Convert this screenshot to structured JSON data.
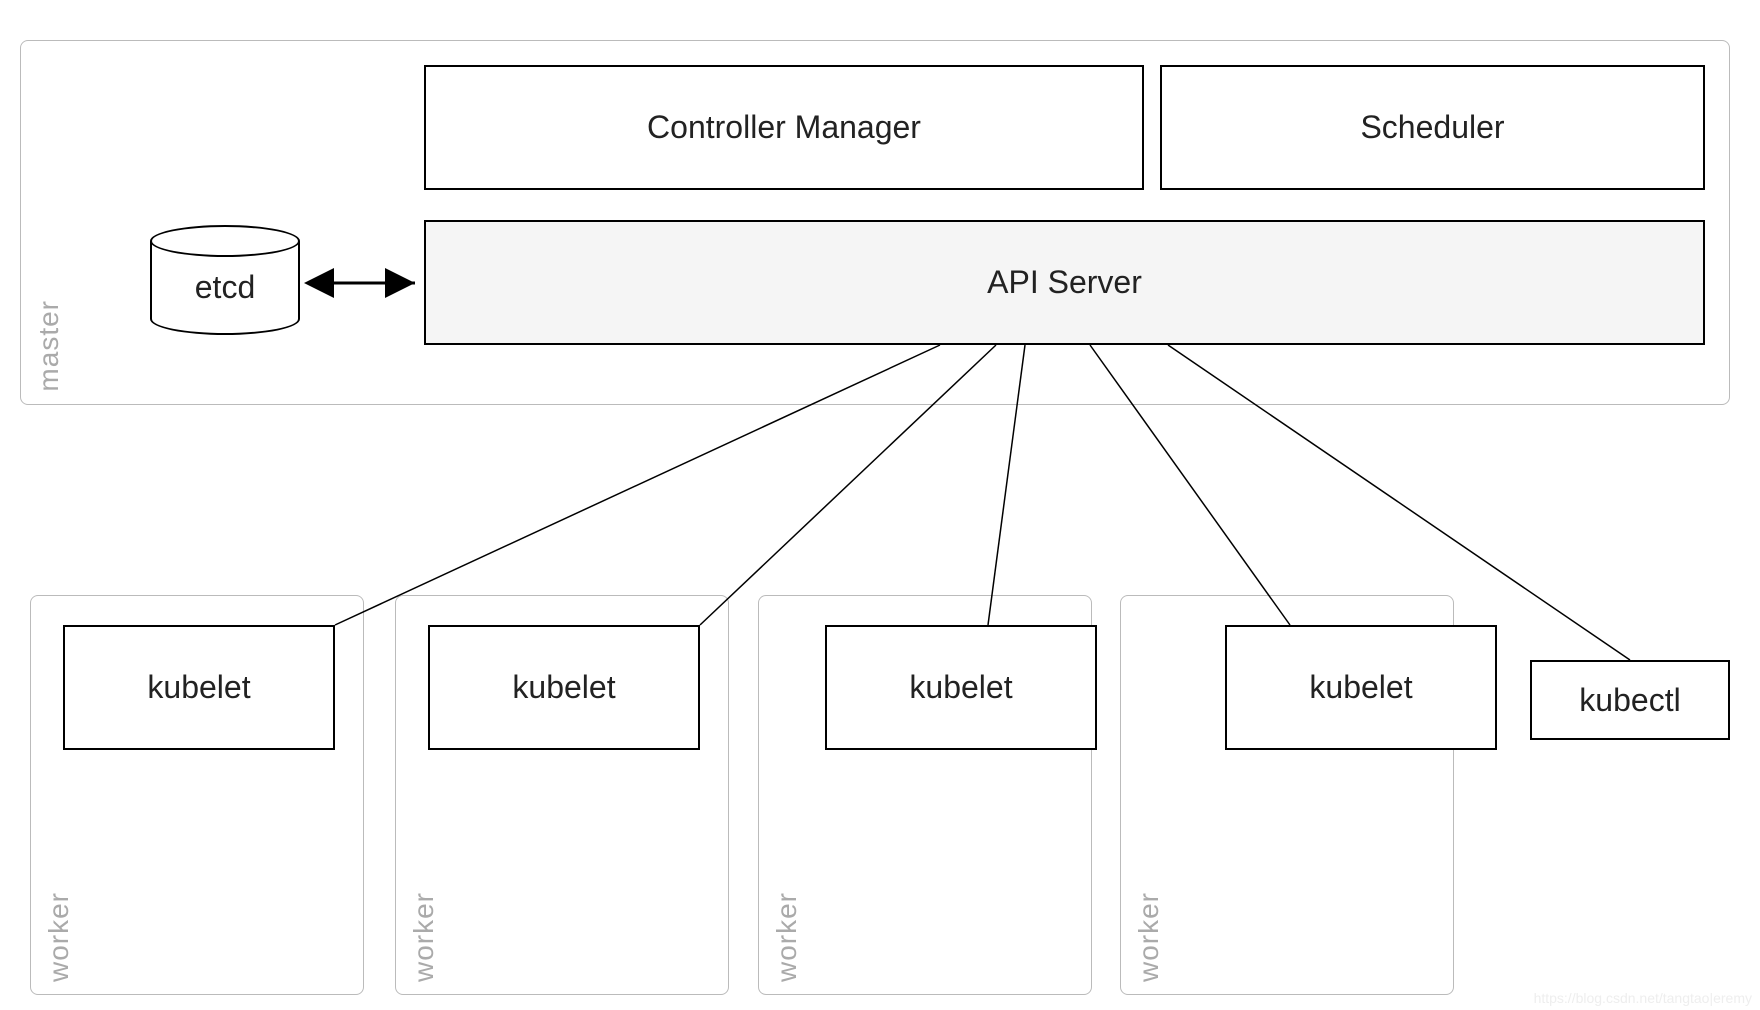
{
  "diagram": {
    "master": {
      "label": "master",
      "etcd": "etcd",
      "controller_manager": "Controller Manager",
      "scheduler": "Scheduler",
      "api_server": "API Server"
    },
    "workers": [
      {
        "label": "worker",
        "kubelet": "kubelet"
      },
      {
        "label": "worker",
        "kubelet": "kubelet"
      },
      {
        "label": "worker",
        "kubelet": "kubelet"
      },
      {
        "label": "worker",
        "kubelet": "kubelet"
      }
    ],
    "kubectl": "kubectl",
    "watermark": "https://blog.csdn.net/tangtao|eremy"
  }
}
